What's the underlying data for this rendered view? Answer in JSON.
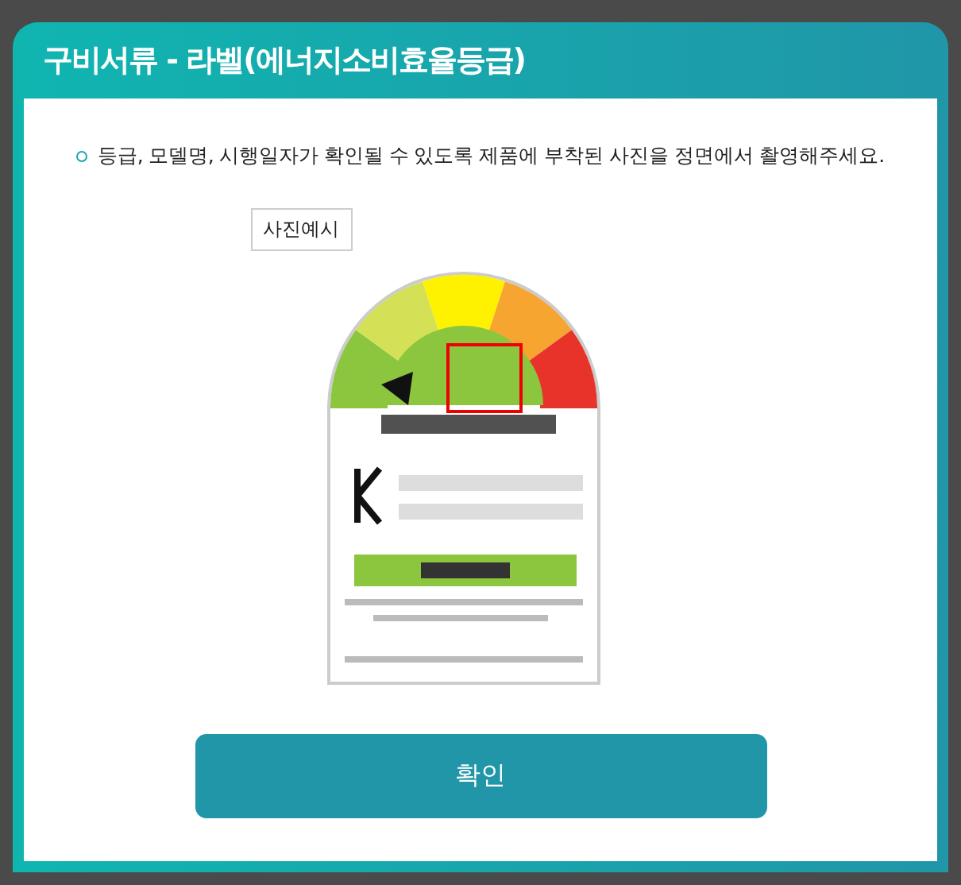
{
  "dialog": {
    "title": "구비서류 - 라벨(에너지소비효율등급)",
    "instruction": "등급, 모델명, 시행일자가 확인될 수 있도록 제품에 부착된 사진을 정면에서 촬영해주세요.",
    "example_tag": "사진예시",
    "buttons": [
      "확인"
    ]
  }
}
